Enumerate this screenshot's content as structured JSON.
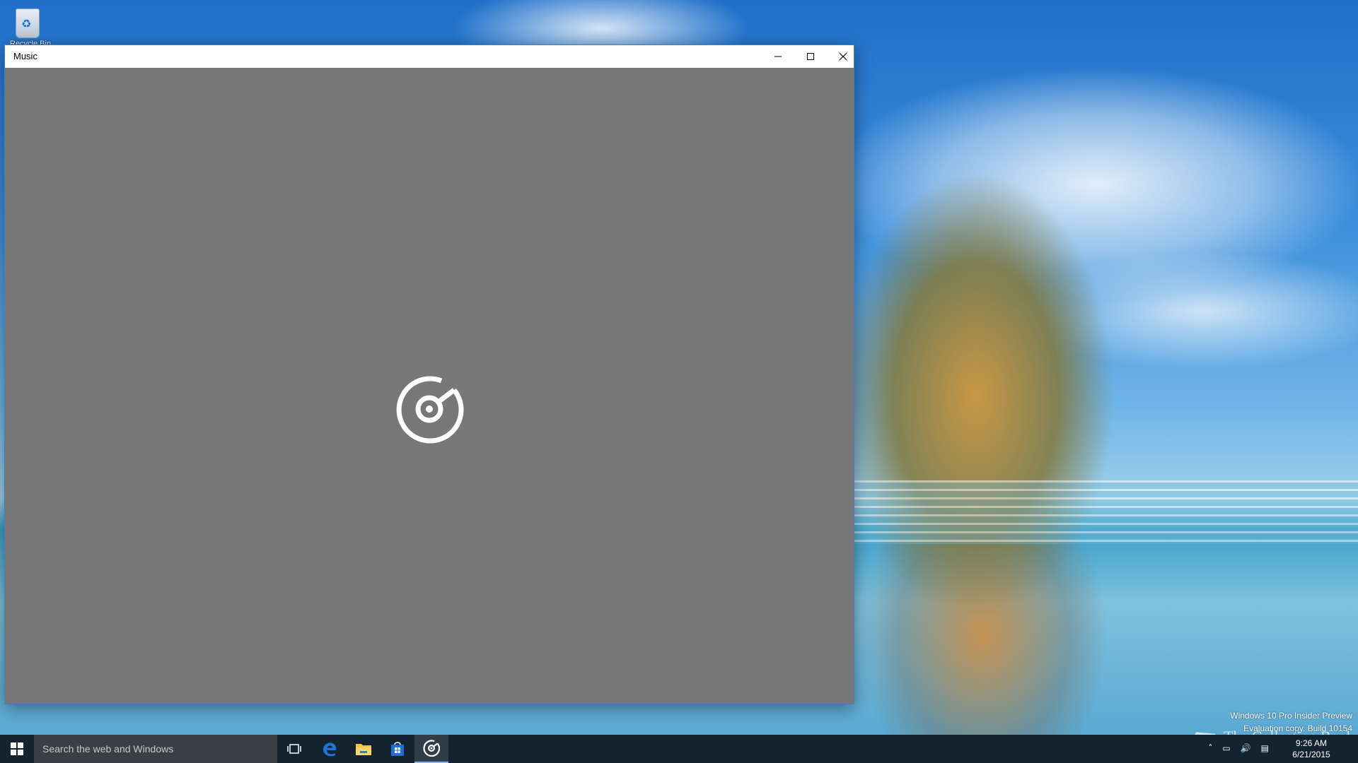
{
  "desktop": {
    "recycle_bin_label": "Recycle Bin"
  },
  "window": {
    "title": "Music",
    "controls": {
      "minimize": "minimize-icon",
      "maximize": "maximize-icon",
      "close": "close-icon"
    },
    "splash_icon": "groove-music-icon"
  },
  "watermark": {
    "line1": "Windows 10 Pro Insider Preview",
    "line2": "Evaluation copy. Build 10154",
    "brand": "The Collection Book"
  },
  "taskbar": {
    "search_placeholder": "Search the web and Windows",
    "pinned": [
      "task-view-icon",
      "edge-icon",
      "file-explorer-icon",
      "store-icon",
      "groove-music-icon"
    ],
    "tray": {
      "time": "9:26 AM",
      "date": "6/21/2015"
    }
  },
  "colors": {
    "taskbar": "#14232f",
    "window_background": "#777777",
    "titlebar": "#ffffff",
    "edge_blue": "#1e73d6",
    "store_blue": "#1d6fd1"
  }
}
